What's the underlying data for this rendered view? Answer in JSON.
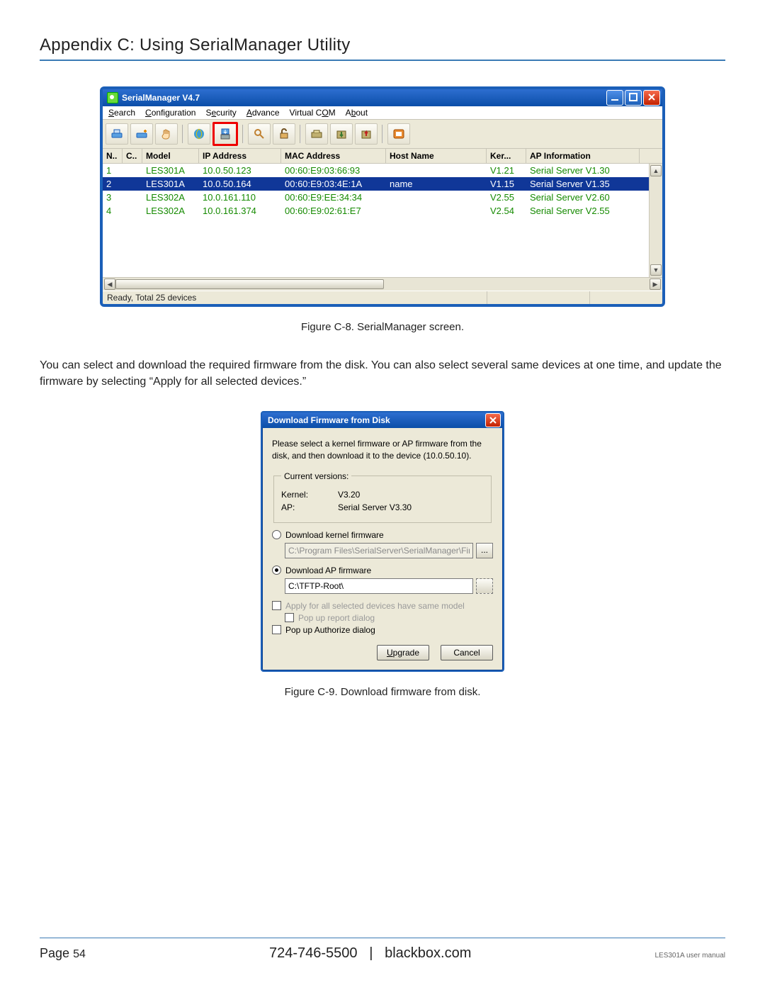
{
  "page": {
    "appendix_title": "Appendix C: Using SerialManager Utility",
    "caption_main": "Figure C-8. SerialManager screen.",
    "body_text": "You can select and download the required firmware from the disk. You can also select several same devices at one time, and update the firmware by selecting “Apply for all selected devices.”",
    "caption_dialog": "Figure C-9. Download firmware from disk.",
    "footer_page_label": "Page",
    "footer_page_num": "54",
    "footer_phone": "724-746-5500",
    "footer_divider": "|",
    "footer_site": "blackbox.com",
    "footer_doc": "LES301A user manual"
  },
  "window": {
    "title": "SerialManager V4.7",
    "menu": [
      "Search",
      "Configuration",
      "Security",
      "Advance",
      "Virtual COM",
      "About"
    ],
    "menu_underline_idx": [
      0,
      0,
      1,
      0,
      9,
      1
    ],
    "columns": [
      "N..",
      "C..",
      "Model",
      "IP Address",
      "MAC Address",
      "Host Name",
      "Ker...",
      "AP Information"
    ],
    "rows": [
      {
        "n": "1",
        "c": "",
        "model": "LES301A",
        "ip": "10.0.50.123",
        "mac": "00:60:E9:03:66:93",
        "host": "",
        "ker": "V1.21",
        "ap": "Serial Server V1.30",
        "sel": false
      },
      {
        "n": "2",
        "c": "",
        "model": "LES301A",
        "ip": "10.0.50.164",
        "mac": "00:60:E9:03:4E:1A",
        "host": "name",
        "ker": "V1.15",
        "ap": "Serial Server V1.35",
        "sel": true
      },
      {
        "n": "3",
        "c": "",
        "model": "LES302A",
        "ip": "10.0.161.110",
        "mac": "00:60:E9:EE:34:34",
        "host": "",
        "ker": "V2.55",
        "ap": "Serial Server V2.60",
        "sel": false
      },
      {
        "n": "4",
        "c": "",
        "model": "LES302A",
        "ip": "10.0.161.374",
        "mac": "00:60:E9:02:61:E7",
        "host": "",
        "ker": "V2.54",
        "ap": "Serial Server V2.55",
        "sel": false
      }
    ],
    "status": "Ready, Total 25 devices"
  },
  "dialog": {
    "title": "Download Firmware from Disk",
    "intro": "Please select a kernel firmware or AP firmware from the disk, and then download it to the device (10.0.50.10).",
    "cv_legend": "Current versions:",
    "kernel_label": "Kernel:",
    "kernel_value": "V3.20",
    "ap_label": "AP:",
    "ap_value": "Serial Server V3.30",
    "radio_kernel": "Download kernel firmware",
    "kernel_path": "C:\\Program Files\\SerialServer\\SerialManager\\Firm",
    "radio_ap": "Download AP firmware",
    "ap_path": "C:\\TFTP-Root\\",
    "chk_apply": "Apply for all selected devices have same model",
    "chk_report": "Pop up report dialog",
    "chk_auth": "Pop up Authorize dialog",
    "btn_upgrade": "Upgrade",
    "btn_cancel": "Cancel"
  }
}
